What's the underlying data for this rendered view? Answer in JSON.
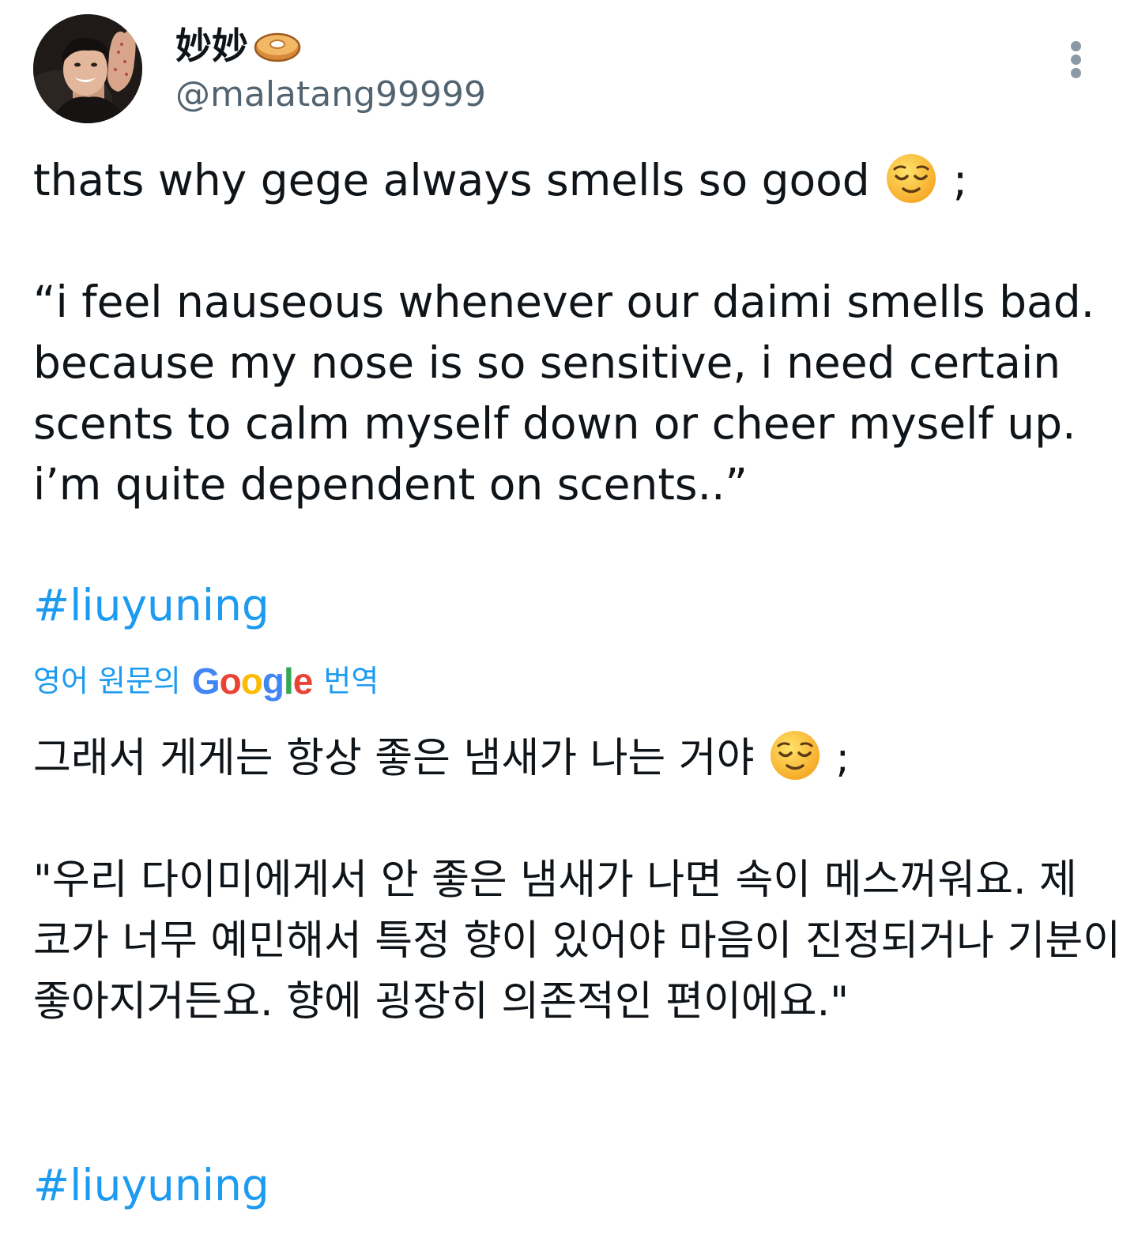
{
  "author": {
    "display_name": "妙妙",
    "name_emoji_icon": "bagel-icon",
    "handle": "@malatang99999",
    "avatar_icon": "profile-photo"
  },
  "menu": {
    "icon": "more-vertical-icon"
  },
  "tweet": {
    "line1_text": "thats why gege always smells so good ",
    "line1_emoji": "relieved-face-icon",
    "line1_suffix": " ;",
    "quote": "“i feel nauseous whenever our daimi smells bad. because my nose is so sensitive, i need certain scents to calm myself down or cheer myself up. i’m quite dependent on scents..”",
    "hashtag": "#liuyuning"
  },
  "translation": {
    "prefix": "영어 원문의",
    "provider": [
      "G",
      "o",
      "o",
      "g",
      "l",
      "e"
    ],
    "suffix": "번역",
    "line1_text": "그래서 게게는 항상 좋은 냄새가 나는 거야 ",
    "line1_emoji": "relieved-face-icon",
    "line1_suffix": " ;",
    "quote": "\"우리 다이미에게서 안 좋은 냄새가 나면 속이 메스꺼워요. 제 코가 너무 예민해서 특정 향이 있어야 마음이 진정되거나 기분이 좋아지거든요. 향에 굉장히 의존적인 편이에요.\"",
    "hashtag": "#liuyuning"
  },
  "colors": {
    "text": "#0f1419",
    "secondary": "#536471",
    "link": "#1d9bf0",
    "menu_dots": "#8b98a5"
  }
}
